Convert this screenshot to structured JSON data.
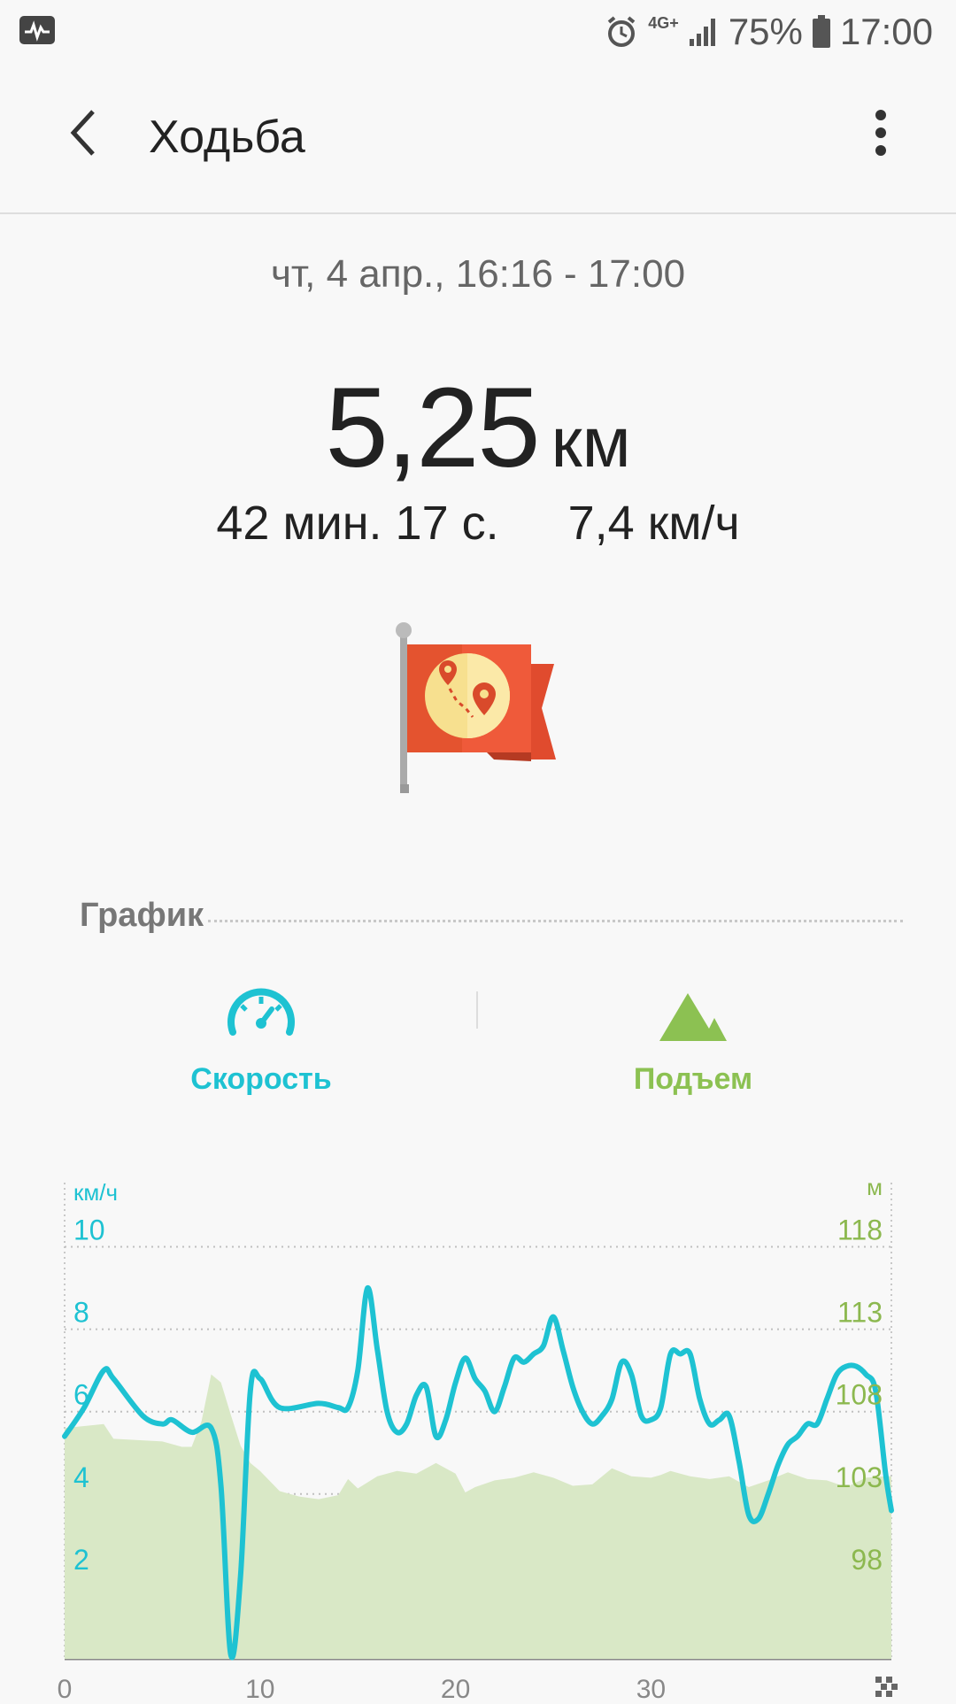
{
  "status_bar": {
    "time": "17:00",
    "battery": "75%",
    "network": "4G+"
  },
  "app_bar": {
    "title": "Ходьба"
  },
  "workout": {
    "date_range": "чт, 4 апр., 16:16 - 17:00",
    "distance_value": "5,25",
    "distance_unit": "км",
    "duration": "42 мин. 17 с.",
    "avg_speed": "7,4 км/ч"
  },
  "graph_section": {
    "title": "График"
  },
  "tabs": [
    {
      "label": "Скорость",
      "icon": "speedometer-icon",
      "color": "#1ec2d2"
    },
    {
      "label": "Подъем",
      "icon": "mountain-icon",
      "color": "#8cc152"
    }
  ],
  "chart_data": {
    "type": "line",
    "left_axis_unit": "км/ч",
    "right_axis_unit": "м",
    "left_ticks": [
      "10",
      "8",
      "6",
      "4",
      "2"
    ],
    "right_ticks": [
      "118",
      "113",
      "108",
      "103",
      "98"
    ],
    "x_ticks": [
      "0",
      "10",
      "20",
      "30"
    ],
    "xlim": [
      0,
      42.3
    ],
    "ylim_speed": [
      0,
      11.3
    ],
    "ylim_elevation": [
      91.8,
      126.5
    ],
    "grid": true,
    "speed_color": "#1ec2d2",
    "elevation_color": "#d9e8c6",
    "left_tick_color": "#1ec2d2",
    "right_tick_color": "#8cb84f",
    "series": [
      {
        "name": "Скорость",
        "x": [
          0,
          1,
          2,
          2.5,
          4,
          5,
          5.5,
          6.5,
          7.5,
          8,
          8.5,
          9,
          9.5,
          10,
          11,
          13,
          14,
          14.5,
          15,
          15.5,
          16,
          16.5,
          17,
          17.5,
          18,
          18.5,
          19,
          19.5,
          20,
          20.5,
          21,
          21.5,
          22,
          22.5,
          23,
          23.5,
          24,
          24.5,
          25,
          25.5,
          26,
          26.5,
          27,
          27.5,
          28,
          28.5,
          29,
          29.5,
          30,
          30.5,
          31,
          31.5,
          32,
          32.5,
          33,
          33.5,
          34,
          34.5,
          35,
          35.5,
          36,
          36.5,
          37,
          37.5,
          38,
          38.5,
          39,
          39.5,
          40,
          40.5,
          41,
          41.5,
          42,
          42.3
        ],
        "values": [
          5.4,
          6.1,
          7.0,
          6.8,
          5.9,
          5.7,
          5.8,
          5.5,
          5.6,
          4.2,
          0.1,
          2.0,
          6.5,
          6.8,
          6.1,
          6.2,
          6.1,
          6.1,
          7.0,
          9.0,
          7.5,
          6.0,
          5.5,
          5.7,
          6.4,
          6.6,
          5.4,
          5.8,
          6.7,
          7.3,
          6.8,
          6.5,
          6.0,
          6.6,
          7.3,
          7.2,
          7.4,
          7.6,
          8.3,
          7.5,
          6.6,
          6.0,
          5.7,
          5.9,
          6.3,
          7.2,
          6.9,
          5.9,
          5.8,
          6.1,
          7.4,
          7.4,
          7.4,
          6.3,
          5.7,
          5.8,
          5.9,
          4.8,
          3.5,
          3.4,
          4.0,
          4.7,
          5.2,
          5.4,
          5.7,
          5.7,
          6.3,
          6.9,
          7.1,
          7.1,
          6.9,
          6.5,
          4.5,
          3.6
        ]
      },
      {
        "name": "Подъем",
        "x": [
          0,
          2,
          2.5,
          5,
          6,
          6.5,
          7,
          7.5,
          8,
          8.5,
          9,
          9.5,
          10,
          11,
          12,
          13,
          14,
          14.5,
          15,
          16,
          17,
          18,
          19,
          20,
          20.5,
          21,
          22,
          23,
          24,
          25,
          26,
          27,
          28,
          29,
          30,
          30.5,
          31,
          32,
          33,
          34,
          35,
          36,
          37,
          38,
          39,
          40,
          41,
          42,
          42.3
        ],
        "values": [
          109.0,
          109.3,
          108.2,
          108.0,
          107.6,
          107.6,
          109.5,
          113.0,
          112.4,
          110.0,
          107.7,
          106.4,
          105.8,
          104.3,
          103.9,
          103.7,
          104.0,
          105.2,
          104.5,
          105.4,
          105.8,
          105.6,
          106.4,
          105.6,
          104.2,
          104.6,
          105.1,
          105.3,
          105.7,
          105.3,
          104.7,
          104.8,
          106.0,
          105.4,
          105.3,
          105.5,
          105.8,
          105.4,
          105.2,
          105.4,
          104.6,
          105.1,
          105.7,
          105.2,
          105.1,
          104.6,
          105.3,
          105.4,
          105.4
        ]
      }
    ]
  }
}
